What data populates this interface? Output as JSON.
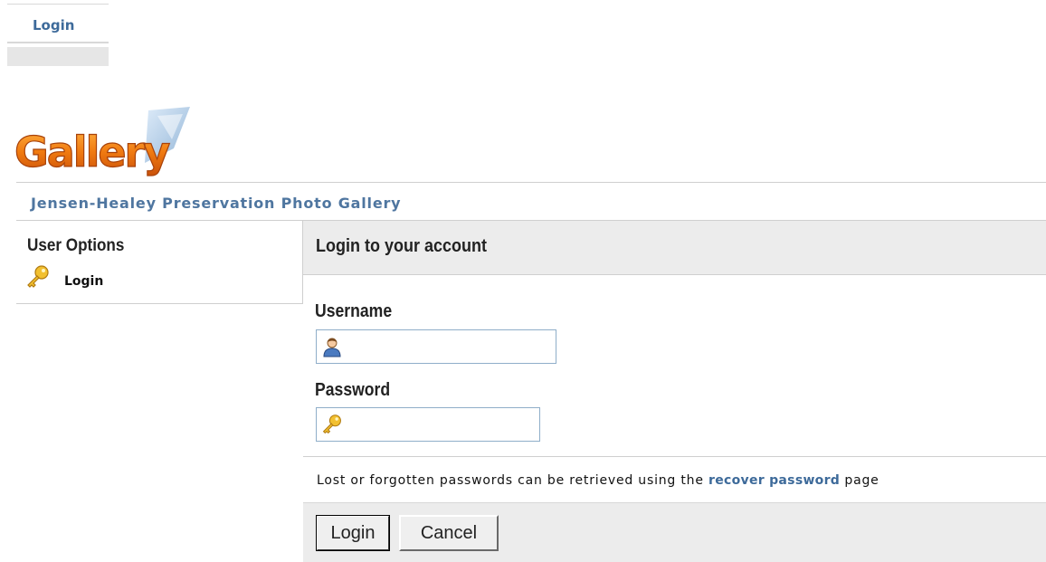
{
  "top_tab": {
    "label": "Login"
  },
  "logo": {
    "text": "Gallery"
  },
  "site": {
    "title": "Jensen-Healey Preservation Photo Gallery"
  },
  "sidebar": {
    "title": "User Options",
    "items": [
      {
        "label": "Login",
        "icon": "key-icon"
      }
    ]
  },
  "main": {
    "title": "Login to your account",
    "username": {
      "label": "Username",
      "value": "",
      "icon": "user-icon"
    },
    "password": {
      "label": "Password",
      "value": "",
      "icon": "key-icon"
    },
    "help_text_before": "Lost or forgotten passwords can be retrieved using the ",
    "help_link": "recover password",
    "help_text_after": " page",
    "buttons": {
      "login": "Login",
      "cancel": "Cancel"
    }
  },
  "colors": {
    "link": "#3d6a9a",
    "site_title": "#4f76a0",
    "panel_bg": "#ececec",
    "logo_orange": "#e06a0a"
  }
}
